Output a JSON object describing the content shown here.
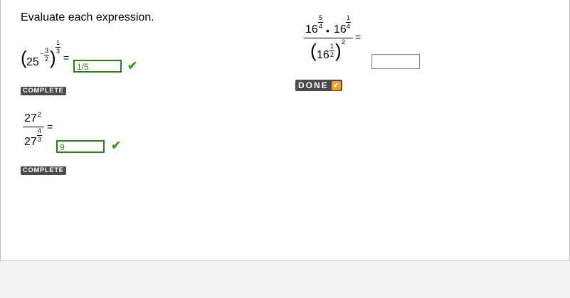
{
  "instructions": "Evaluate each expression.",
  "problem1": {
    "base": "25",
    "inner_exp_sign": "−",
    "inner_exp_num": "3",
    "inner_exp_den": "2",
    "outer_exp_num": "1",
    "outer_exp_den": "3",
    "equals": "=",
    "answer": "1/5",
    "status": "COMPLETE"
  },
  "problem2": {
    "num_base": "27",
    "num_exp": "2",
    "den_base": "27",
    "den_exp_num": "4",
    "den_exp_den": "3",
    "equals": "=",
    "answer": "9",
    "status": "COMPLETE"
  },
  "problem3": {
    "num_base1": "16",
    "num_exp1_num": "5",
    "num_exp1_den": "4",
    "dot": "•",
    "num_base2": "16",
    "num_exp2_num": "1",
    "num_exp2_den": "4",
    "den_base": "16",
    "den_inner_exp_num": "1",
    "den_inner_exp_den": "2",
    "den_outer_exp": "2",
    "equals": "=",
    "answer": "",
    "button_label": "DONE"
  },
  "colors": {
    "correct": "#2e7d1b",
    "badge": "#4a4a4a",
    "done_check": "#f5a020"
  }
}
